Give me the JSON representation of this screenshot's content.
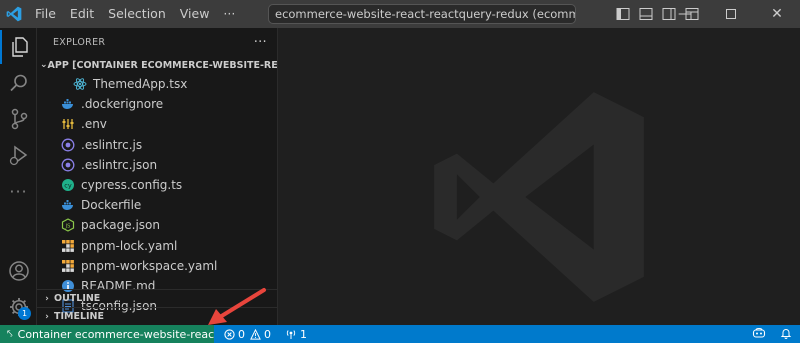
{
  "titlebar": {
    "menu": [
      "File",
      "Edit",
      "Selection",
      "View"
    ],
    "more_label": "···",
    "command_center": "ecommerce-website-react-reactquery-redux (ecommerce-website-react-"
  },
  "sidebar": {
    "header": "EXPLORER",
    "more": "···",
    "root_label": "APP [CONTAINER ECOMMERCE-WEBSITE-REACT-REA...",
    "files": [
      {
        "name": "ThemedApp.tsx",
        "icon": "react-icon"
      },
      {
        "name": ".dockerignore",
        "icon": "docker-icon"
      },
      {
        "name": ".env",
        "icon": "env-icon"
      },
      {
        "name": ".eslintrc.js",
        "icon": "eslint-icon"
      },
      {
        "name": ".eslintrc.json",
        "icon": "eslint-icon"
      },
      {
        "name": "cypress.config.ts",
        "icon": "cypress-icon"
      },
      {
        "name": "Dockerfile",
        "icon": "docker-icon"
      },
      {
        "name": "package.json",
        "icon": "node-icon"
      },
      {
        "name": "pnpm-lock.yaml",
        "icon": "pnpm-icon"
      },
      {
        "name": "pnpm-workspace.yaml",
        "icon": "pnpm-icon"
      },
      {
        "name": "README.md",
        "icon": "info-icon"
      },
      {
        "name": "tsconfig.json",
        "icon": "tsconfig-icon"
      }
    ],
    "outline_label": "OUTLINE",
    "timeline_label": "TIMELINE"
  },
  "activitybar": {
    "accounts_badge": "1"
  },
  "statusbar": {
    "remote_label": "Container ecommerce-website-react-reactq...",
    "errors": "0",
    "warnings": "0",
    "ports": "1"
  },
  "colors": {
    "accent": "#0078d4",
    "statusbar": "#007acc",
    "remote": "#16825d",
    "annotation_arrow": "#e8453c"
  }
}
